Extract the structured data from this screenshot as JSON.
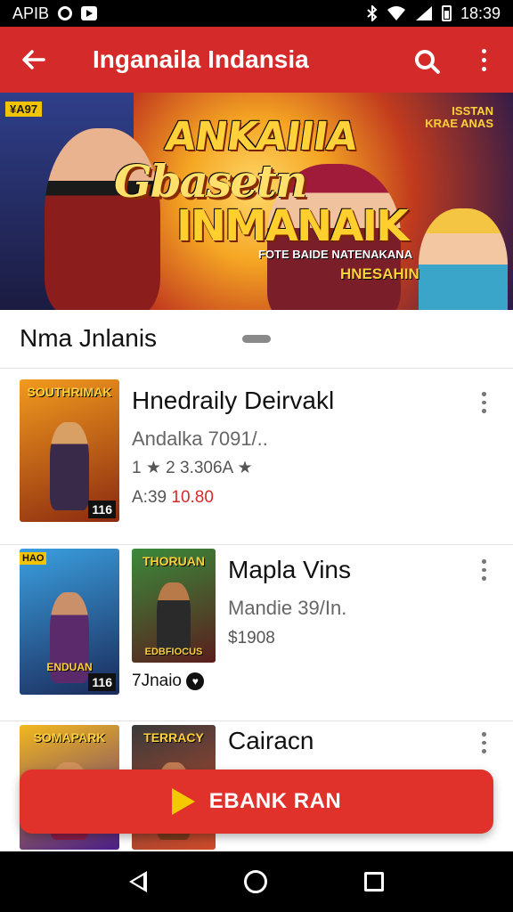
{
  "status_bar": {
    "left_text": "APIB",
    "time": "18:39",
    "icons": [
      "record-icon",
      "play-box-icon",
      "bluetooth-icon",
      "wifi-icon",
      "signal-icon",
      "battery-icon"
    ]
  },
  "app_bar": {
    "title": "Inganaila Indansia",
    "back_icon": "arrow-left-icon",
    "actions": [
      "search-icon",
      "more-vert-icon"
    ]
  },
  "banner": {
    "tag_left": "¥A97",
    "tag_right": "ISSTAN KRAE ANAS",
    "line1": "ANKAIIIA",
    "line2": "Gbasetn",
    "line3": "INMANAIK",
    "subline": "FOTE BAIDE NATENAKANA",
    "subline2": "HNESAHIN"
  },
  "section": {
    "title": "Nma Jnlanis"
  },
  "items": [
    {
      "title": "Hnedraily Deirvakl",
      "subtitle": "Andalka 7091/..",
      "meta": "1 ★ 2 3.306A ★",
      "price_prefix": "A:39",
      "price_sale": "10.80",
      "covers": [
        {
          "title": "SOUTHRIMAK",
          "badge": "116",
          "colors": [
            "#f29a1e",
            "#8a2a10"
          ]
        }
      ]
    },
    {
      "title": "Mapla Vins",
      "subtitle": "Mandie 39/In.",
      "price": "$1908",
      "caption": "7Jnaio",
      "covers": [
        {
          "title": "",
          "tag": "HAO",
          "badge": "116",
          "caption": "ENDUAN",
          "colors": [
            "#3aa0e0",
            "#1b2a5a"
          ]
        },
        {
          "title": "THORUAN",
          "badge": "",
          "caption": "EDBFIOCUS",
          "colors": [
            "#3a8a3a",
            "#5a1e1e"
          ]
        }
      ]
    },
    {
      "title": "Cairacn",
      "covers": [
        {
          "title": "SOMAPARK",
          "badge": "",
          "colors": [
            "#f2b81e",
            "#4a1e8a"
          ]
        },
        {
          "title": "TERRACY",
          "badge": "",
          "colors": [
            "#3a3a3a",
            "#d04a2a"
          ]
        }
      ]
    }
  ],
  "cta": {
    "label": "EBANK RAN"
  },
  "nav_bar": [
    "back-triangle-icon",
    "home-circle-icon",
    "recents-square-icon"
  ],
  "colors": {
    "primary": "#d42a2a",
    "cta": "#e0312b",
    "accent_yellow": "#f5c800"
  }
}
